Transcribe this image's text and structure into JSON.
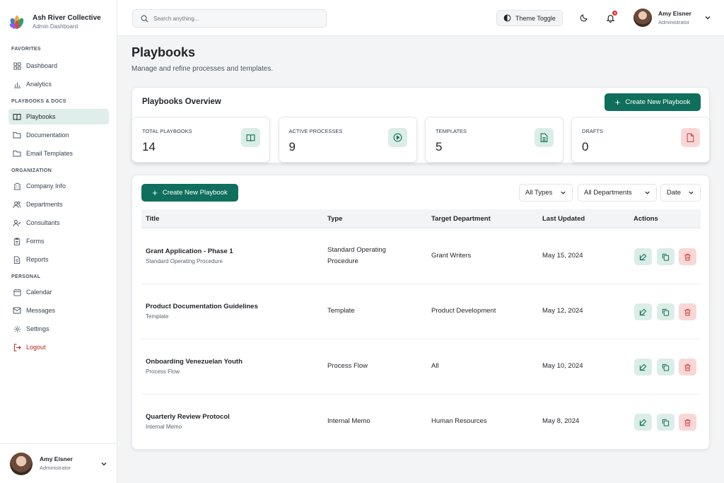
{
  "brand": {
    "name": "Ash River Collective",
    "subtitle": "Admin Dashboard"
  },
  "sidebar": {
    "sections": [
      {
        "label": "FAVORITES",
        "items": [
          {
            "label": "Dashboard",
            "icon": "grid-icon"
          },
          {
            "label": "Analytics",
            "icon": "bar-chart-icon"
          }
        ]
      },
      {
        "label": "PLAYBOOKS & DOCS",
        "items": [
          {
            "label": "Playbooks",
            "icon": "book-icon",
            "active": true
          },
          {
            "label": "Documentation",
            "icon": "folder-icon"
          },
          {
            "label": "Email Templates",
            "icon": "folder-icon"
          }
        ]
      },
      {
        "label": "ORGANIZATION",
        "items": [
          {
            "label": "Company Info",
            "icon": "building-icon"
          },
          {
            "label": "Departments",
            "icon": "users-icon"
          },
          {
            "label": "Consultants",
            "icon": "user-check-icon"
          },
          {
            "label": "Forms",
            "icon": "clipboard-icon"
          },
          {
            "label": "Reports",
            "icon": "file-text-icon"
          }
        ]
      },
      {
        "label": "PERSONAL",
        "items": [
          {
            "label": "Calendar",
            "icon": "calendar-icon"
          },
          {
            "label": "Messages",
            "icon": "mail-icon"
          },
          {
            "label": "Settings",
            "icon": "gear-icon"
          },
          {
            "label": "Logout",
            "icon": "logout-icon"
          }
        ]
      }
    ],
    "user": {
      "name": "Amy Eisner",
      "role": "Administrator"
    }
  },
  "topbar": {
    "search_placeholder": "Search anything...",
    "theme_toggle_label": "Theme Toggle",
    "notification_count": "4",
    "user": {
      "name": "Amy Eisner",
      "role": "Administrator"
    }
  },
  "page": {
    "title": "Playbooks",
    "subtitle": "Manage and refine processes and templates."
  },
  "overview": {
    "title": "Playbooks Overview",
    "create_label": "Create New Playbook",
    "stats": [
      {
        "label": "TOTAL PLAYBOOKS",
        "value": "14",
        "icon": "book-open-icon",
        "tone": "green"
      },
      {
        "label": "ACTIVE PROCESSES",
        "value": "9",
        "icon": "play-circle-icon",
        "tone": "green"
      },
      {
        "label": "TEMPLATES",
        "value": "5",
        "icon": "document-icon",
        "tone": "green"
      },
      {
        "label": "DRAFTS",
        "value": "0",
        "icon": "draft-file-icon",
        "tone": "red"
      }
    ]
  },
  "table": {
    "create_label": "Create New Playbook",
    "filters": {
      "type": "All Types",
      "department": "All Departments",
      "date": "Date"
    },
    "columns": [
      "Title",
      "Type",
      "Target Department",
      "Last Updated",
      "Actions"
    ],
    "rows": [
      {
        "title": "Grant Application - Phase 1",
        "subtitle": "Standard Operating Procedure",
        "type": "Standard Operating Procedure",
        "department": "Grant Writers",
        "updated": "May 15, 2024"
      },
      {
        "title": "Product Documentation Guidelines",
        "subtitle": "Template",
        "type": "Template",
        "department": "Product Development",
        "updated": "May 12, 2024"
      },
      {
        "title": "Onboarding Venezuelan Youth",
        "subtitle": "Process Flow",
        "type": "Process Flow",
        "department": "All",
        "updated": "May 10, 2024"
      },
      {
        "title": "Quarterly Review Protocol",
        "subtitle": "Internal Memo",
        "type": "Internal Memo",
        "department": "Human Resources",
        "updated": "May 8, 2024"
      }
    ]
  },
  "colors": {
    "accent": "#0f6f5c",
    "accent_soft": "#dbede7",
    "danger": "#d64545",
    "danger_soft": "#f8d8d6"
  }
}
